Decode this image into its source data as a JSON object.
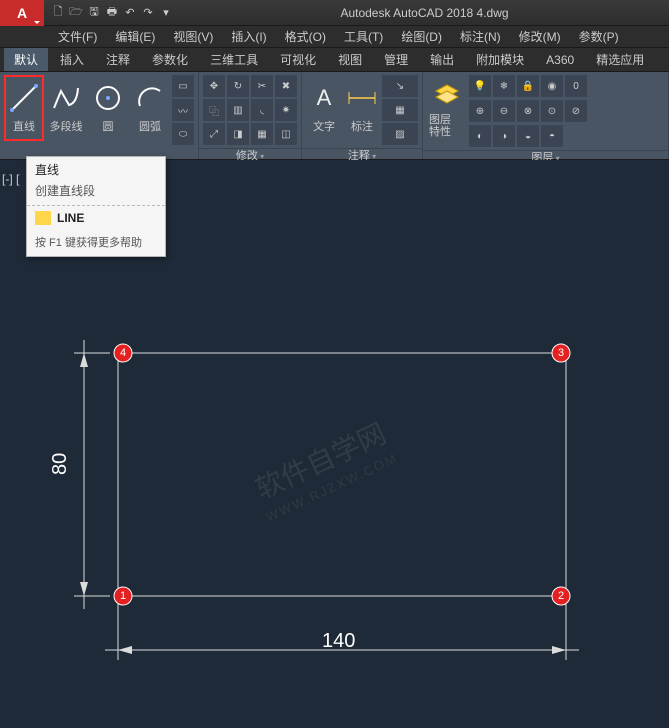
{
  "title": "Autodesk AutoCAD 2018   4.dwg",
  "menu": [
    "文件(F)",
    "编辑(E)",
    "视图(V)",
    "插入(I)",
    "格式(O)",
    "工具(T)",
    "绘图(D)",
    "标注(N)",
    "修改(M)",
    "参数(P)"
  ],
  "ribbontabs": [
    "默认",
    "插入",
    "注释",
    "参数化",
    "三维工具",
    "可视化",
    "视图",
    "管理",
    "输出",
    "附加模块",
    "A360",
    "精选应用"
  ],
  "draw": {
    "line": "直线",
    "polyline": "多段线",
    "circle": "圆",
    "arc": "圆弧"
  },
  "panels": {
    "modify": "修改",
    "annotate": "注释",
    "layers": "图层"
  },
  "annotate": {
    "text": "文字",
    "dim": "标注"
  },
  "layerbtn": "图层\n特性",
  "tooltip": {
    "title": "直线",
    "desc": "创建直线段",
    "cmd": "LINE",
    "help": "按 F1 键获得更多帮助"
  },
  "viewport_marker": "[-] [",
  "dimensions": {
    "width": "140",
    "height": "80"
  },
  "points": [
    "1",
    "2",
    "3",
    "4"
  ],
  "qat": [
    "▤",
    "▯",
    "⤺",
    "⤻",
    "▾"
  ]
}
